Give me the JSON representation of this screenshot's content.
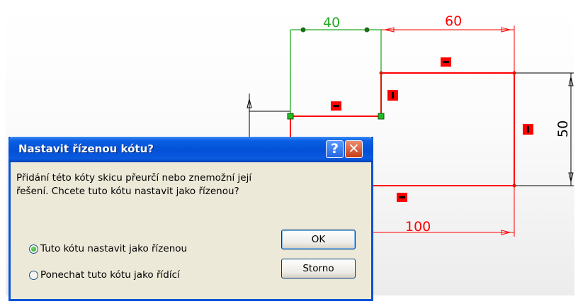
{
  "sketch": {
    "dimensions": {
      "d40": "40",
      "d60": "60",
      "d50": "50",
      "d100": "100"
    }
  },
  "dialog": {
    "title": "Nastavit řízenou kótu?",
    "help_glyph": "?",
    "close_glyph": "✕",
    "message_line1": "Přidání této kóty skicu přeurčí nebo znemožní její",
    "message_line2": "řešení.  Chcete tuto kótu nastavit jako řízenou?",
    "options": [
      {
        "label": "Tuto kótu nastavit jako řízenou",
        "selected": true
      },
      {
        "label": "Ponechat tuto kótu jako řídící",
        "selected": false
      }
    ],
    "ok_label": "OK",
    "cancel_label": "Storno"
  },
  "colors": {
    "sketch_red": "#ff0000",
    "sketch_green": "#22aa22",
    "titlebar_blue": "#0250d6",
    "dialog_bg": "#ece9d8"
  }
}
